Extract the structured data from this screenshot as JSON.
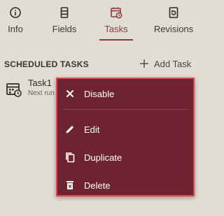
{
  "tabs": [
    {
      "label": "Info",
      "icon": "info-icon"
    },
    {
      "label": "Fields",
      "icon": "fields-icon"
    },
    {
      "label": "Tasks",
      "icon": "tasks-icon",
      "active": true
    },
    {
      "label": "Revisions",
      "icon": "revisions-icon"
    }
  ],
  "section": {
    "title": "SCHEDULED TASKS",
    "add_label": "Add Task"
  },
  "task": {
    "name": "Task1",
    "subtitle": "Next run"
  },
  "menu": {
    "items": [
      {
        "label": "Disable",
        "icon": "close-icon"
      },
      {
        "label": "Edit",
        "icon": "pencil-icon"
      },
      {
        "label": "Duplicate",
        "icon": "duplicate-icon"
      },
      {
        "label": "Delete",
        "icon": "trash-icon"
      }
    ]
  },
  "colors": {
    "background": "#e1ddd2",
    "accent": "#8a3b47",
    "menu_background": "#6e2430",
    "menu_border": "#e0454d"
  }
}
